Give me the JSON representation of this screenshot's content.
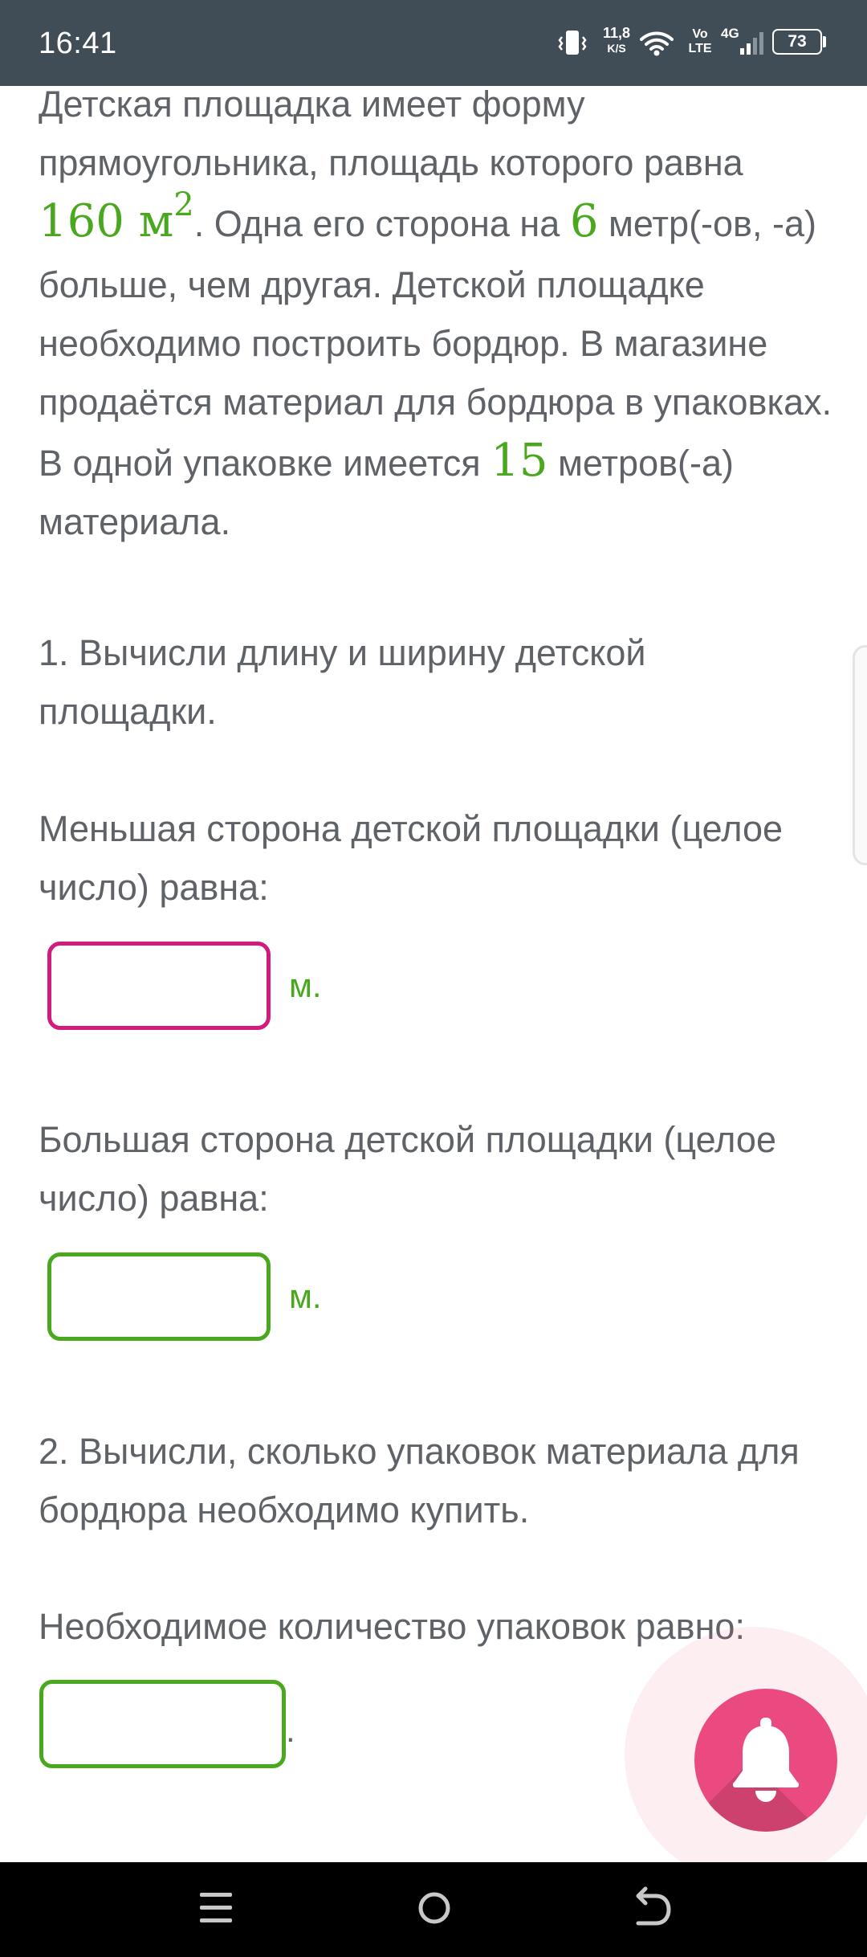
{
  "status_bar": {
    "time": "16:41",
    "net_speed_value": "11,8",
    "net_speed_unit": "K/S",
    "volte_top": "Vo",
    "volte_bottom": "LTE",
    "network_type": "4G",
    "battery_level": "73",
    "icons": [
      "vibrate-icon",
      "wifi-icon",
      "signal-icon",
      "battery-icon"
    ]
  },
  "problem": {
    "part1": "Детская площадка имеет форму прямоугольника, площадь которого равна ",
    "area_value": "160",
    "area_unit": "м",
    "area_exponent": "2",
    "part2": ". Одна его сторона на ",
    "difference_value": "6",
    "part3": " метр(-ов, -а) больше, чем другая. Детской площадке необходимо построить бордюр. В магазине продаётся материал для бордюра в упаковках. В одной упаковке имеется ",
    "pack_length_value": "15",
    "part4": " метров(-а) материала."
  },
  "task1": {
    "text": "1. Вычисли длину и ширину детской площадки.",
    "smaller_label": "Меньшая сторона детской площадки (целое число) равна:",
    "smaller_value": "",
    "smaller_unit": "м.",
    "larger_label": "Большая сторона детской площадки (целое число) равна:",
    "larger_value": "",
    "larger_unit": "м."
  },
  "task2": {
    "text": "2. Вычисли, сколько упаковок материала для бордюра необходимо купить.",
    "packs_label": "Необходимое количество упаковок равно:",
    "packs_value": "",
    "packs_suffix": "."
  },
  "fab": {
    "icon": "bell-icon"
  },
  "nav_bar": {
    "icons": [
      "menu-nav-icon",
      "home-nav-icon",
      "back-nav-icon"
    ]
  },
  "colors": {
    "status_bar": "#414d56",
    "text": "#5f6368",
    "accent_green": "#4aa81f",
    "active_input_border": "#d21b7c",
    "fab": "#ea4a7f",
    "nav_bar": "#000000"
  }
}
